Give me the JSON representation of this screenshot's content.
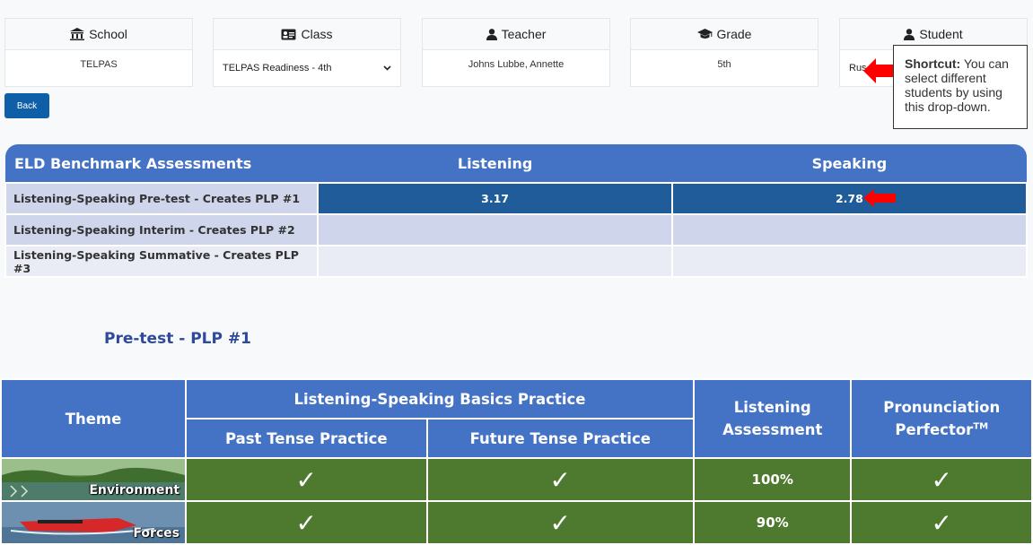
{
  "filters": {
    "school": {
      "label": "School",
      "value": "TELPAS",
      "icon": "bank-icon"
    },
    "class": {
      "label": "Class",
      "value": "TELPAS Readiness - 4th",
      "icon": "id-card-icon"
    },
    "teacher": {
      "label": "Teacher",
      "value": "Johns Lubbe, Annette",
      "icon": "user-icon"
    },
    "grade": {
      "label": "Grade",
      "value": "5th",
      "icon": "graduation-cap-icon"
    },
    "student": {
      "label": "Student",
      "value": "Rus",
      "icon": "user-icon"
    }
  },
  "back_label": "Back",
  "callout": {
    "bold": "Shortcut:",
    "text": " You can select different students by using this drop-down."
  },
  "eld": {
    "headers": [
      "ELD Benchmark Assessments",
      "Listening",
      "Speaking"
    ],
    "rows": [
      {
        "label": "Listening-Speaking Pre-test - Creates PLP #1",
        "listening": "3.17",
        "speaking": "2.78"
      },
      {
        "label": "Listening-Speaking Interim - Creates PLP #2",
        "listening": "",
        "speaking": ""
      },
      {
        "label": "Listening-Speaking Summative - Creates PLP #3",
        "listening": "",
        "speaking": ""
      }
    ]
  },
  "section_title": "Pre-test - PLP #1",
  "plp": {
    "theme_header": "Theme",
    "basics_header": "Listening-Speaking Basics Practice",
    "past_header": "Past Tense Practice",
    "future_header": "Future Tense Practice",
    "listening_header_1": "Listening",
    "listening_header_2": "Assessment",
    "pron_header_1": "Pronunciation",
    "pron_header_2": "Perfector",
    "pron_tm": "TM",
    "check": "✓",
    "rows": [
      {
        "theme": "Environment",
        "listening": "100%"
      },
      {
        "theme": "Forces",
        "listening": "90%"
      }
    ]
  },
  "colors": {
    "header_blue": "#4472c4",
    "score_blue": "#1f5c99",
    "complete_green": "#4e7a2f",
    "arrow_red": "#ff0000"
  }
}
